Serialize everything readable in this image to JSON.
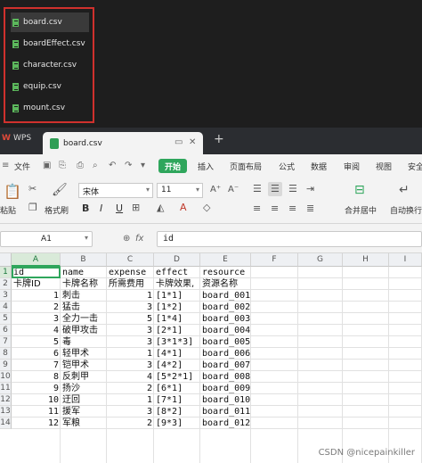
{
  "file_list": [
    "board.csv",
    "boardEffect.csv",
    "character.csv",
    "equip.csv",
    "mount.csv"
  ],
  "titlebar": {
    "app": "WPS",
    "tab": "board.csv",
    "new_tab": "+"
  },
  "menu": {
    "file": "文件",
    "start": "开始",
    "items": [
      "插入",
      "页面布局",
      "公式",
      "数据",
      "审阅",
      "视图",
      "安全"
    ]
  },
  "ribbon": {
    "paste": "粘贴",
    "format_painter": "格式刷",
    "font": "宋体",
    "size": "11",
    "bold": "B",
    "italic": "I",
    "underline": "U",
    "merge": "合并居中",
    "autowrap": "自动换行"
  },
  "formula": {
    "cell_ref": "A1",
    "fx": "fx",
    "value": "id"
  },
  "grid": {
    "columns": [
      "A",
      "B",
      "C",
      "D",
      "E",
      "F",
      "G",
      "H",
      "I"
    ],
    "rows": [
      "1",
      "2",
      "3",
      "4",
      "5",
      "6",
      "7",
      "8",
      "9",
      "10",
      "11",
      "12",
      "13",
      "14"
    ],
    "header1": [
      "id",
      "name",
      "expense",
      "effect",
      "resource"
    ],
    "header2": [
      "卡牌ID",
      "卡牌名称",
      "所需费用",
      "卡牌效果,",
      "资源名称"
    ],
    "data": [
      [
        "1",
        "刺击",
        "1",
        "[1*1]",
        "board_001"
      ],
      [
        "2",
        "猛击",
        "3",
        "[1*2]",
        "board_002"
      ],
      [
        "3",
        "全力一击",
        "5",
        "[1*4]",
        "board_003"
      ],
      [
        "4",
        "破甲攻击",
        "3",
        "[2*1]",
        "board_004"
      ],
      [
        "5",
        "毒",
        "3",
        "[3*1*3]",
        "board_005"
      ],
      [
        "6",
        "轻甲术",
        "1",
        "[4*1]",
        "board_006"
      ],
      [
        "7",
        "铠甲术",
        "3",
        "[4*2]",
        "board_007"
      ],
      [
        "8",
        "反刺甲",
        "4",
        "[5*2*1]",
        "board_008"
      ],
      [
        "9",
        "扬沙",
        "2",
        "[6*1]",
        "board_009"
      ],
      [
        "10",
        "迂回",
        "1",
        "[7*1]",
        "board_010"
      ],
      [
        "11",
        "援军",
        "3",
        "[8*2]",
        "board_011"
      ],
      [
        "12",
        "军粮",
        "2",
        "[9*3]",
        "board_012"
      ]
    ]
  },
  "watermark": "CSDN @nicepainkiller"
}
